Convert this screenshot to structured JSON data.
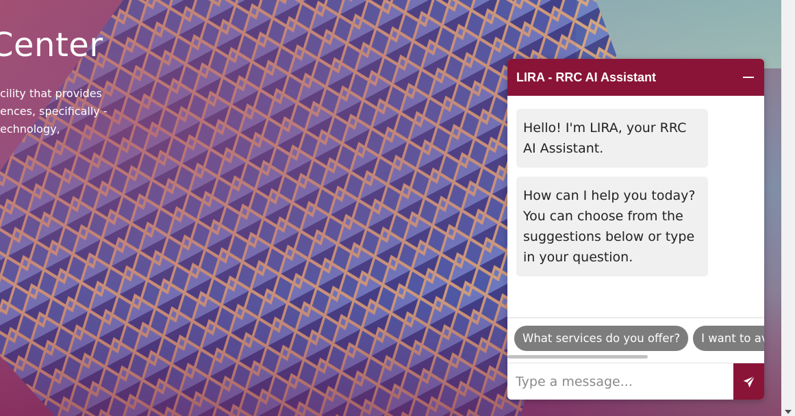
{
  "hero": {
    "title": "Center",
    "lines": [
      "cility that provides",
      "ences, specifically -",
      "echnology,"
    ]
  },
  "chat": {
    "title": "LIRA - RRC AI Assistant",
    "messages": [
      "Hello! I'm LIRA, your RRC AI Assistant.",
      "How can I help you today? You can choose from the suggestions below or type in your question."
    ],
    "suggestions": [
      "What services do you offer?",
      "I want to avai"
    ],
    "input_placeholder": "Type a message...",
    "icons": {
      "minimize": "minimize-icon",
      "send": "send-icon"
    }
  },
  "colors": {
    "brand": "#8a1437",
    "chip": "#7d7d7d",
    "bubble": "#f0f0f0"
  }
}
